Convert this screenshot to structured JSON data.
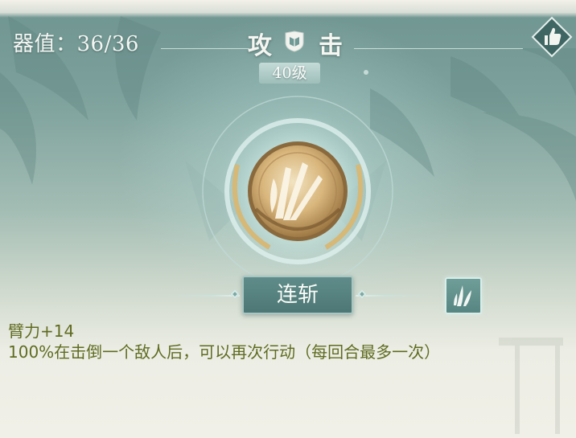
{
  "equipment": {
    "stat_label": "器值：36/36",
    "title_left": "攻",
    "title_right": "击",
    "level": "40级",
    "emblem_icon": "shield-book-icon",
    "like_icon": "thumbs-up-icon"
  },
  "skill": {
    "icon": "bamboo-leaf-skill-icon",
    "name": "连斩",
    "swap_icon": "bamboo-leaf-icon"
  },
  "effects": {
    "bonus": "臂力+14",
    "description": "100%在击倒一个敌人后，可以再次行动（每回合最多一次）"
  },
  "colors": {
    "effect_text": "#5f6b20",
    "panel_teal": "#4d7774",
    "gold": "#c9a462"
  }
}
